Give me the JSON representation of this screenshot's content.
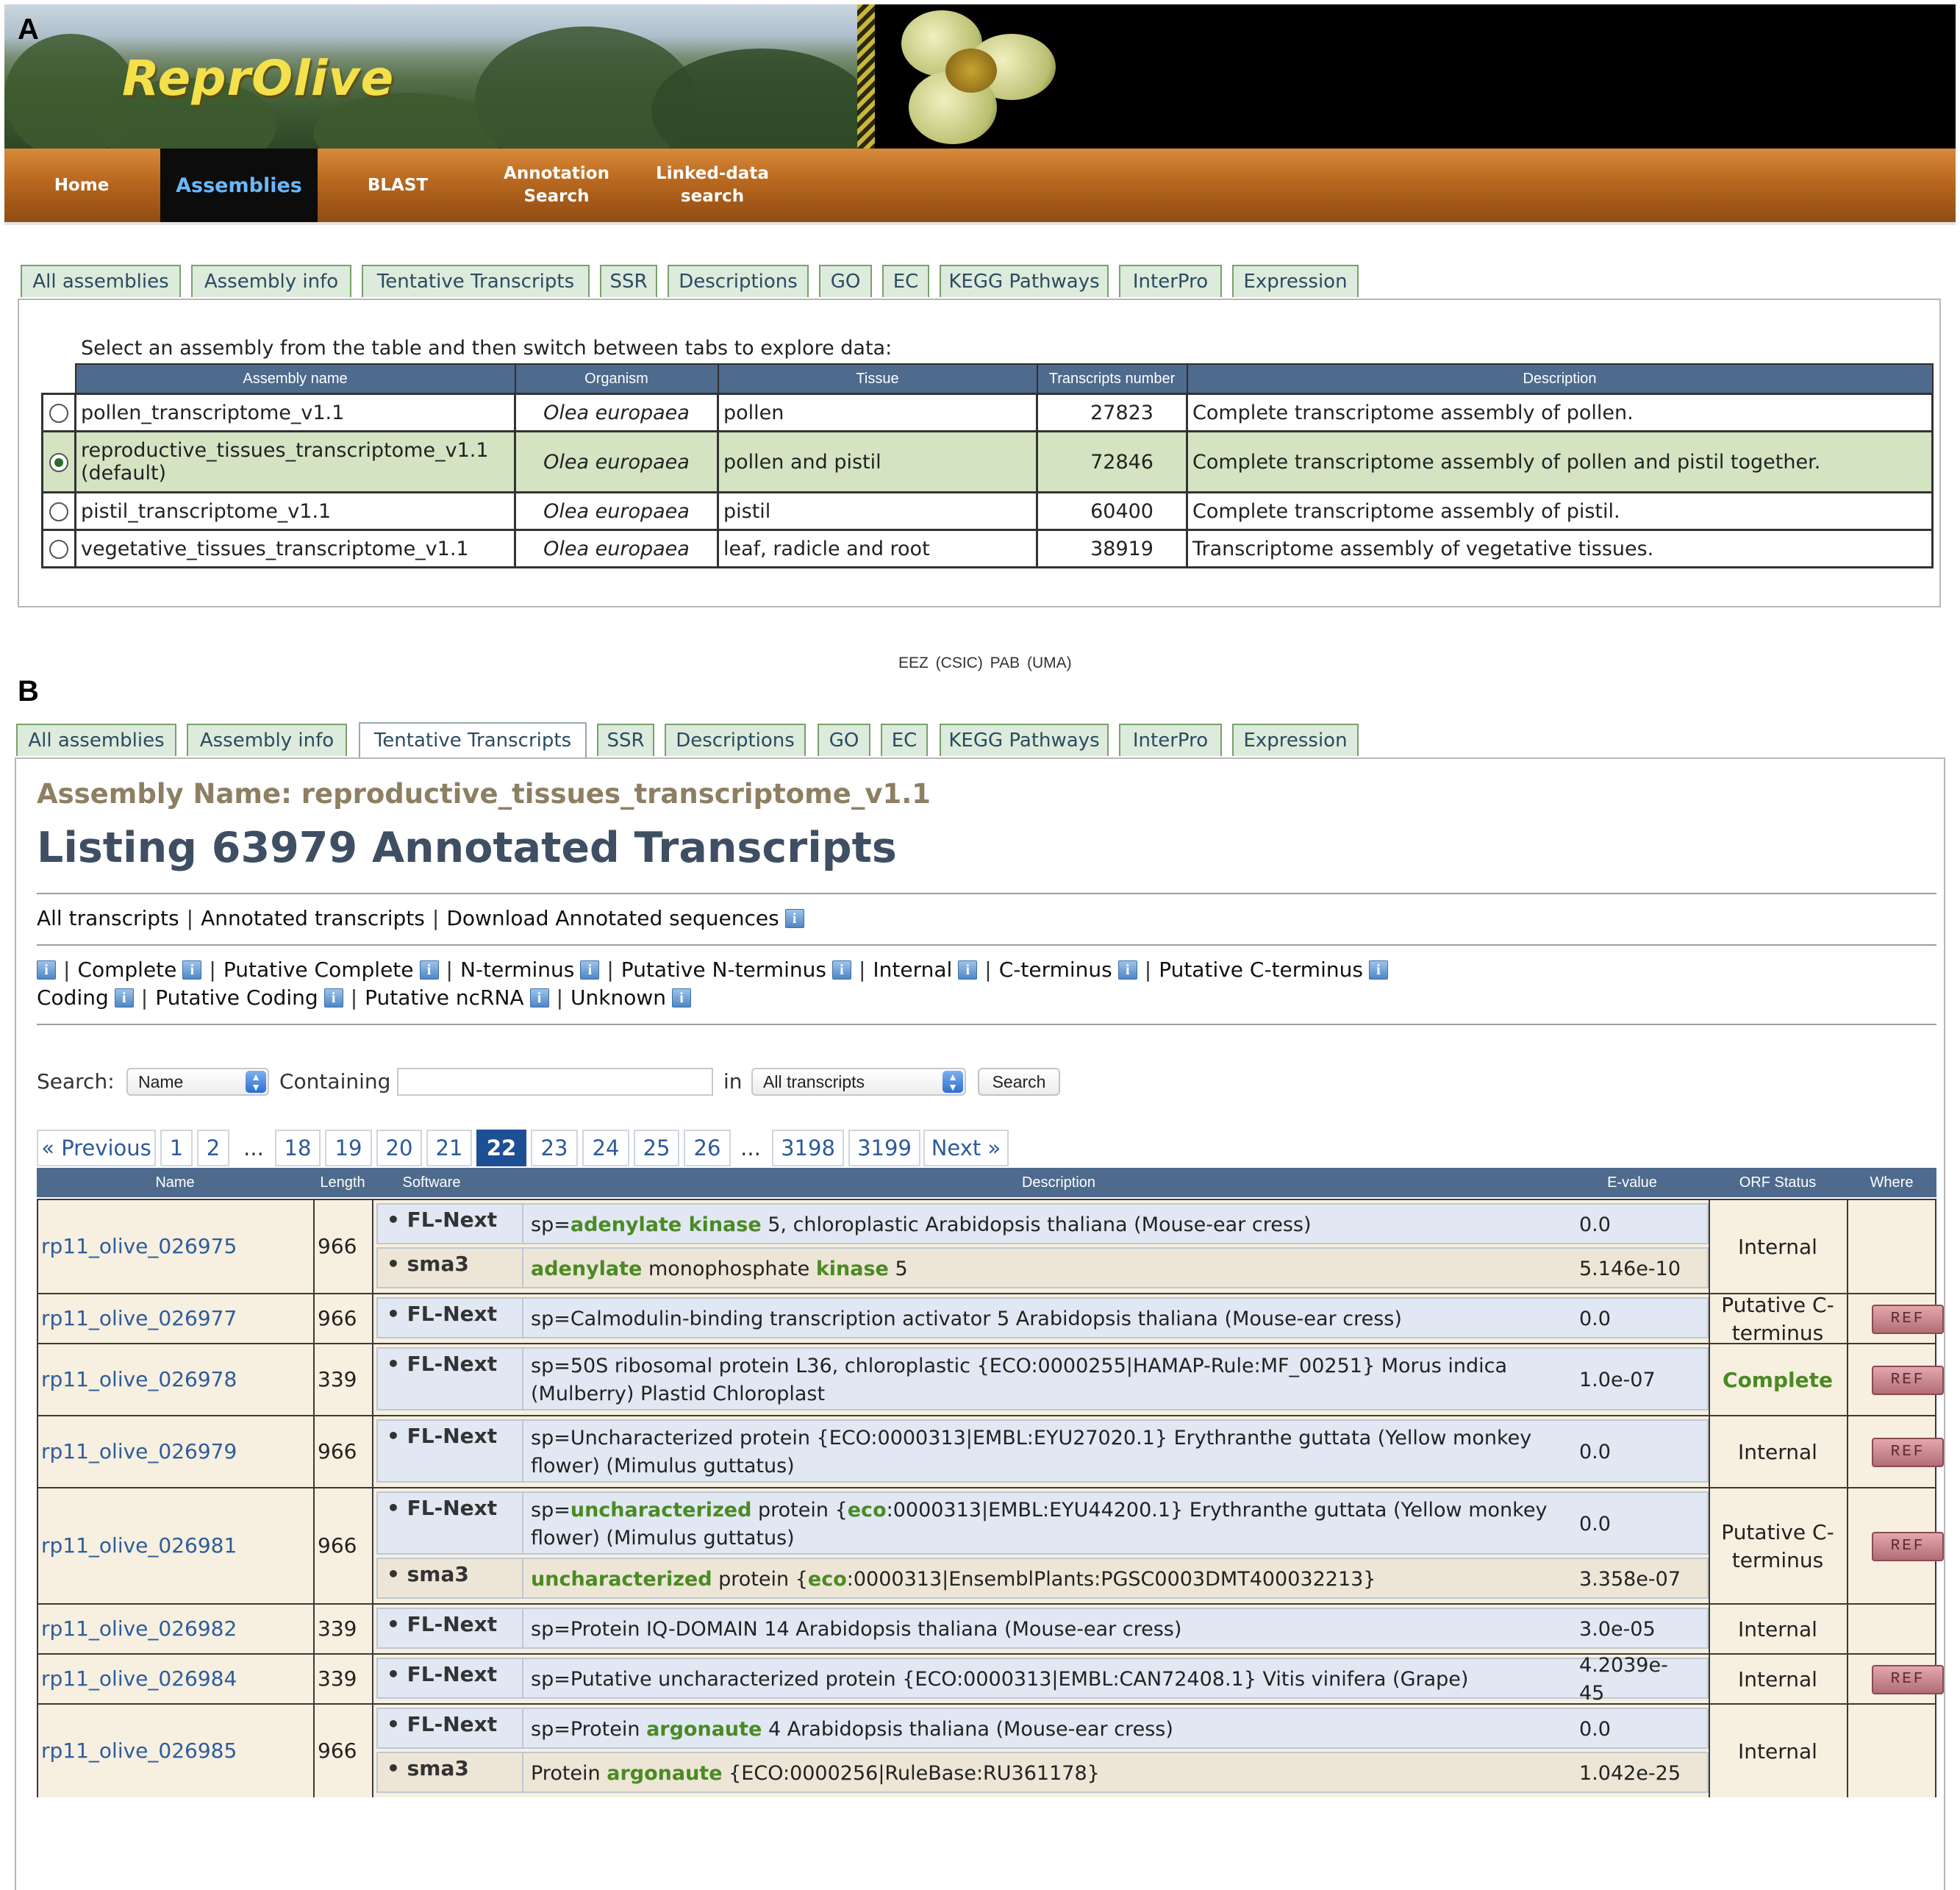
{
  "panel_letters": {
    "a": "A",
    "b": "B"
  },
  "banner": {
    "title": "ReprOlive"
  },
  "nav": {
    "items": [
      "Home",
      "Assemblies",
      "BLAST",
      "Annotation Search",
      "Linked-data search"
    ],
    "active": "Assemblies"
  },
  "tabs": [
    "All assemblies",
    "Assembly info",
    "Tentative Transcripts",
    "SSR",
    "Descriptions",
    "GO",
    "EC",
    "KEGG Pathways",
    "InterPro",
    "Expression"
  ],
  "assemblies": {
    "intro": "Select an assembly from the table and then switch between tabs to explore data:",
    "columns": [
      "Assembly name",
      "Organism",
      "Tissue",
      "Transcripts number",
      "Description"
    ],
    "rows": [
      {
        "name": "pollen_transcriptome_v1.1",
        "organism": "Olea europaea",
        "tissue": "pollen",
        "transcripts": "27823",
        "description": "Complete transcriptome assembly of pollen.",
        "selected": false
      },
      {
        "name": "reproductive_tissues_transcriptome_v1.1",
        "note": "(default)",
        "organism": "Olea europaea",
        "tissue": "pollen and pistil",
        "transcripts": "72846",
        "description": "Complete transcriptome assembly of pollen and pistil together.",
        "selected": true
      },
      {
        "name": "pistil_transcriptome_v1.1",
        "organism": "Olea europaea",
        "tissue": "pistil",
        "transcripts": "60400",
        "description": "Complete transcriptome assembly of pistil.",
        "selected": false
      },
      {
        "name": "vegetative_tissues_transcriptome_v1.1",
        "organism": "Olea europaea",
        "tissue": "leaf, radicle and root",
        "transcripts": "38919",
        "description": "Transcriptome assembly of vegetative tissues.",
        "selected": false
      }
    ]
  },
  "footer": {
    "text": "EEZ (CSIC)   PAB (UMA)"
  },
  "transcripts": {
    "active_tab": "Tentative Transcripts",
    "assembly_name": "Assembly Name: reproductive_tissues_transcriptome_v1.1",
    "listing_title": "Listing 63979 Annotated Transcripts",
    "links": {
      "all": "All transcripts",
      "annotated": "Annotated transcripts",
      "download": "Download Annotated sequences"
    },
    "filters_row1": [
      "Complete",
      "Putative Complete",
      "N-terminus",
      "Putative N-terminus",
      "Internal",
      "C-terminus",
      "Putative C-terminus"
    ],
    "filters_row2": [
      "Coding",
      "Putative Coding",
      "Putative ncRNA",
      "Unknown"
    ],
    "info_glyph": "i",
    "search": {
      "label": "Search:",
      "field": "Name",
      "containing": "Containing",
      "in": "in",
      "scope": "All transcripts",
      "button": "Search",
      "query": ""
    },
    "pagination": [
      "« Previous",
      "1",
      "2",
      "...",
      "18",
      "19",
      "20",
      "21",
      "22",
      "23",
      "24",
      "25",
      "26",
      "...",
      "3198",
      "3199",
      "Next »"
    ],
    "current_page": "22",
    "columns": [
      "Name",
      "Length",
      "Software",
      "Description",
      "E-value",
      "ORF Status",
      "Where"
    ],
    "ref_label": "REF",
    "rows": [
      {
        "name": "rp11_olive_026975",
        "length": "966",
        "orf": "Internal",
        "ref": false,
        "hits": [
          {
            "software": "FL-Next",
            "description": "sp=<b>adenylate kinase</b> 5, chloroplastic Arabidopsis thaliana (Mouse-ear cress)",
            "evalue": "0.0"
          },
          {
            "software": "sma3",
            "description": "<b>adenylate</b> monophosphate <b>kinase</b> 5",
            "evalue": "5.146e-10"
          }
        ]
      },
      {
        "name": "rp11_olive_026977",
        "length": "966",
        "orf": "Putative C-terminus",
        "ref": true,
        "hits": [
          {
            "software": "FL-Next",
            "description": "sp=Calmodulin-binding transcription activator 5 Arabidopsis thaliana (Mouse-ear cress)",
            "evalue": "0.0"
          }
        ]
      },
      {
        "name": "rp11_olive_026978",
        "length": "339",
        "orf": "Complete",
        "ref": true,
        "hits": [
          {
            "software": "FL-Next",
            "description": "sp=50S ribosomal protein L36, chloroplastic {ECO:0000255|HAMAP-Rule:MF_00251} Morus indica (Mulberry) Plastid Chloroplast",
            "evalue": "1.0e-07"
          }
        ]
      },
      {
        "name": "rp11_olive_026979",
        "length": "966",
        "orf": "Internal",
        "ref": true,
        "hits": [
          {
            "software": "FL-Next",
            "description": "sp=Uncharacterized protein {ECO:0000313|EMBL:EYU27020.1} Erythranthe guttata (Yellow monkey flower) (Mimulus guttatus)",
            "evalue": "0.0"
          }
        ]
      },
      {
        "name": "rp11_olive_026981",
        "length": "966",
        "orf": "Putative C-terminus",
        "ref": true,
        "hits": [
          {
            "software": "FL-Next",
            "description": "sp=<b>uncharacterized</b> protein {<b>eco</b>:0000313|EMBL:EYU44200.1} Erythranthe guttata (Yellow monkey flower) (Mimulus guttatus)",
            "evalue": "0.0"
          },
          {
            "software": "sma3",
            "description": "<b>uncharacterized</b> protein {<b>eco</b>:0000313|EnsemblPlants:PGSC0003DMT400032213}",
            "evalue": "3.358e-07"
          }
        ]
      },
      {
        "name": "rp11_olive_026982",
        "length": "339",
        "orf": "Internal",
        "ref": false,
        "hits": [
          {
            "software": "FL-Next",
            "description": "sp=Protein IQ-DOMAIN 14 Arabidopsis thaliana (Mouse-ear cress)",
            "evalue": "3.0e-05"
          }
        ]
      },
      {
        "name": "rp11_olive_026984",
        "length": "339",
        "orf": "Internal",
        "ref": true,
        "hits": [
          {
            "software": "FL-Next",
            "description": "sp=Putative uncharacterized protein {ECO:0000313|EMBL:CAN72408.1} Vitis vinifera (Grape)",
            "evalue": "4.2039e-45"
          }
        ]
      },
      {
        "name": "rp11_olive_026985",
        "length": "966",
        "orf": "Internal",
        "ref": false,
        "hits": [
          {
            "software": "FL-Next",
            "description": "sp=Protein <b>argonaute</b> 4 Arabidopsis thaliana (Mouse-ear cress)",
            "evalue": "0.0"
          },
          {
            "software": "sma3",
            "description": "Protein <b>argonaute</b> {ECO:0000256|RuleBase:RU361178}",
            "evalue": "1.042e-25"
          }
        ]
      }
    ]
  },
  "colors": {
    "nav_active": "#0c0c0c",
    "header_blue": "#4e6a8d",
    "highlight_green": "#4a8a23",
    "selected_row": "#d4e4c3"
  }
}
